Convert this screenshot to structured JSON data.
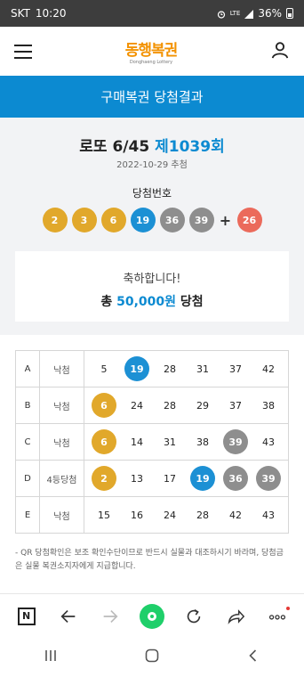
{
  "status_bar": {
    "carrier": "SKT",
    "time": "10:20",
    "network": "LTE",
    "battery": "36%"
  },
  "header": {
    "logo_text": "동행복권",
    "logo_sub": "Donghaeng Lottery"
  },
  "page_title": "구매복권 당첨결과",
  "draw": {
    "game": "로또 6/45",
    "round": "제1039회",
    "date": "2022-10-29 추첨",
    "winning_label": "당첨번호",
    "numbers": [
      "2",
      "3",
      "6",
      "19",
      "36",
      "39"
    ],
    "plus": "+",
    "bonus": "26"
  },
  "result": {
    "congrats": "축하합니다!",
    "total_prefix": "총",
    "amount": "50,000원",
    "total_suffix": "당첨"
  },
  "games": [
    {
      "id": "A",
      "result": "낙첨",
      "numbers": [
        "5",
        "19",
        "28",
        "31",
        "37",
        "42"
      ]
    },
    {
      "id": "B",
      "result": "낙첨",
      "numbers": [
        "6",
        "24",
        "28",
        "29",
        "37",
        "38"
      ]
    },
    {
      "id": "C",
      "result": "낙첨",
      "numbers": [
        "6",
        "14",
        "31",
        "38",
        "39",
        "43"
      ]
    },
    {
      "id": "D",
      "result": "4등당첨",
      "numbers": [
        "2",
        "13",
        "17",
        "19",
        "36",
        "39"
      ]
    },
    {
      "id": "E",
      "result": "낙첨",
      "numbers": [
        "15",
        "16",
        "24",
        "28",
        "42",
        "43"
      ]
    }
  ],
  "notice": "- QR 당첨확인은 보조 확인수단이므로 반드시 실물과 대조하시기 바라며, 당첨금은 실물 복권소지자에게 지급합니다.",
  "colors": {
    "accent": "#0c8ad1",
    "ball_yellow": "#e1a82b",
    "ball_blue": "#1c90d4",
    "ball_gray": "#8e8e8e",
    "ball_red": "#eb6a5b"
  },
  "browser_bar": {
    "icons": [
      "naver-icon",
      "back-arrow-icon",
      "forward-arrow-icon",
      "green-dot-icon",
      "refresh-icon",
      "share-icon",
      "more-icon"
    ]
  },
  "nav_bar": {
    "icons": [
      "recents-icon",
      "home-icon",
      "back-icon"
    ]
  }
}
